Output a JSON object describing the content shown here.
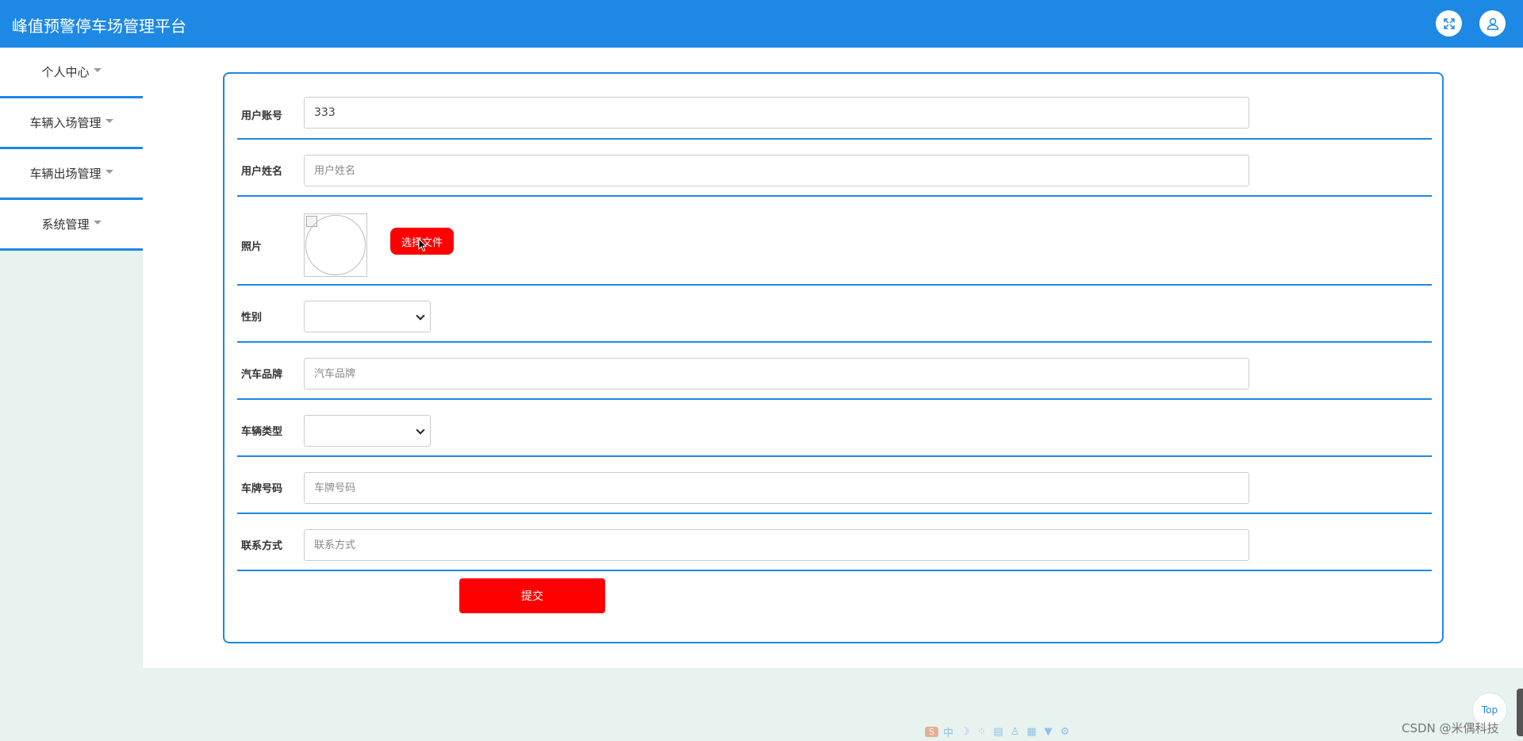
{
  "app": {
    "title": "峰值预警停车场管理平台"
  },
  "header": {
    "expand_icon": "expand-icon",
    "user_icon": "user-icon"
  },
  "sidebar": {
    "items": [
      {
        "label": "个人中心"
      },
      {
        "label": "车辆入场管理"
      },
      {
        "label": "车辆出场管理"
      },
      {
        "label": "系统管理"
      }
    ]
  },
  "form": {
    "account": {
      "label": "用户账号",
      "value": "333"
    },
    "name": {
      "label": "用户姓名",
      "placeholder": "用户姓名",
      "value": ""
    },
    "photo": {
      "label": "照片",
      "button": "选择文件"
    },
    "gender": {
      "label": "性别",
      "selected": ""
    },
    "brand": {
      "label": "汽车品牌",
      "placeholder": "汽车品牌",
      "value": ""
    },
    "vehicle_type": {
      "label": "车辆类型",
      "selected": ""
    },
    "plate": {
      "label": "车牌号码",
      "placeholder": "车牌号码",
      "value": ""
    },
    "contact": {
      "label": "联系方式",
      "placeholder": "联系方式",
      "value": ""
    },
    "submit_label": "提交"
  },
  "ime_toolbar": {
    "items": [
      "中",
      "☽",
      "⁘",
      "▤",
      "♙",
      "▦",
      "▼",
      "⚙"
    ]
  },
  "top_button": {
    "label": "Top"
  },
  "watermark": {
    "text": "CSDN @米偶科技"
  },
  "colors": {
    "primary": "#1e88e5",
    "accent": "#ff0000",
    "background": "#e8f2ee"
  }
}
